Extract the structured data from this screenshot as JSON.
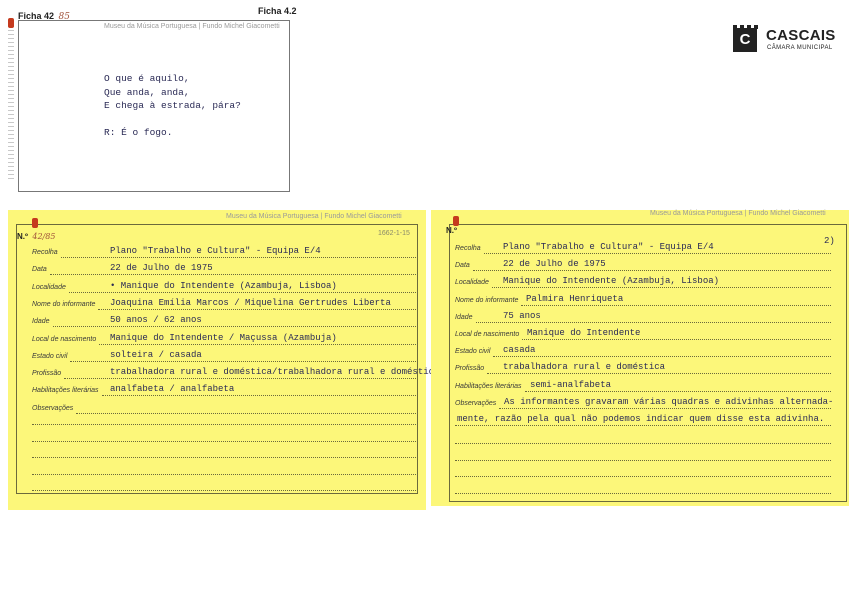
{
  "header": {
    "ficha_left_label": "Ficha 42",
    "ficha_left_hand": "85",
    "ficha_right_label": "Ficha 4.2"
  },
  "logo": {
    "name": "CASCAIS",
    "sub": "CÂMARA MUNICIPAL",
    "mark": "C"
  },
  "card_top": {
    "museum": "Museu da Música Portuguesa | Fundo Michel Giacometti",
    "lines": [
      "O que é aquilo,",
      "Que anda, anda,",
      "E chega à estrada, pára?",
      "",
      "R: É o fogo."
    ]
  },
  "card_left": {
    "museum": "Museu da Música Portuguesa | Fundo Michel Giacometti",
    "number_prefix": "N.º",
    "number_hand": "42/85",
    "corner_code": "1662-1-15",
    "fields": [
      {
        "label": "Recolha",
        "value": "Plano \"Trabalho e Cultura\"  -  Equipa E/4"
      },
      {
        "label": "Data",
        "value": "22 de Julho de 1975"
      },
      {
        "label": "Localidade",
        "value": "• Manique do Intendente (Azambuja, Lisboa)"
      },
      {
        "label": "Nome do informante",
        "value": "Joaquina Emília Marcos / Miquelina Gertrudes Liberta"
      },
      {
        "label": "Idade",
        "value": "50 anos / 62 anos"
      },
      {
        "label": "Local de nascimento",
        "value": "Manique do Intendente / Maçussa (Azambuja)"
      },
      {
        "label": "Estado civil",
        "value": "solteira / casada"
      },
      {
        "label": "Profissão",
        "value": "trabalhadora rural e doméstica/trabalhadora rural e doméstica"
      },
      {
        "label": "Habilitações literárias",
        "value": "analfabeta / analfabeta"
      },
      {
        "label": "Observações",
        "value": ""
      }
    ]
  },
  "card_right": {
    "museum": "Museu da Música Portuguesa | Fundo Michel Giacometti",
    "number_prefix": "N.º",
    "page_no": "2)",
    "fields": [
      {
        "label": "Recolha",
        "value": "Plano \"Trabalho e Cultura\"  -  Equipa E/4"
      },
      {
        "label": "Data",
        "value": "22 de Julho de 1975"
      },
      {
        "label": "Localidade",
        "value": "Manique do Intendente (Azambuja, Lisboa)"
      },
      {
        "label": "Nome do informante",
        "value": "Palmira Henriqueta"
      },
      {
        "label": "Idade",
        "value": "75 anos"
      },
      {
        "label": "Local de nascimento",
        "value": "Manique do Intendente"
      },
      {
        "label": "Estado civil",
        "value": "casada"
      },
      {
        "label": "Profissão",
        "value": "trabalhadora rural e doméstica"
      },
      {
        "label": "Habilitações literárias",
        "value": "semi-analfabeta"
      },
      {
        "label": "Observações",
        "value": "As informantes gravaram várias quadras e adivinhas alternada-"
      }
    ],
    "obs_continuation": "mente, razão pela qual não podemos indicar quem disse esta adivinha."
  }
}
